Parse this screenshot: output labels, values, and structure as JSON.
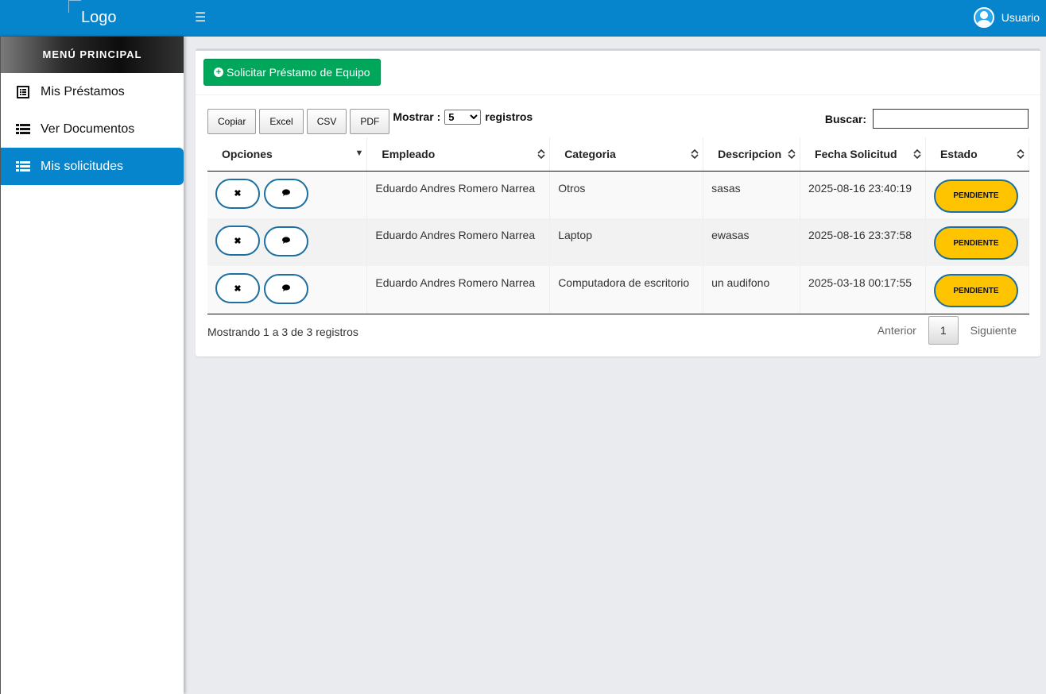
{
  "header": {
    "logo_alt": "Logo",
    "menu_icon": "hamburger-icon",
    "user_label": "Usuario",
    "user_icon": "user-circle-icon",
    "bar_color": "#0785cc"
  },
  "sidebar": {
    "title": "MENÚ PRINCIPAL",
    "items": [
      {
        "label": "Mis Préstamos",
        "icon": "list-alt-icon",
        "active": false
      },
      {
        "label": "Ver Documentos",
        "icon": "list-icon",
        "active": false
      },
      {
        "label": "Mis solicitudes",
        "icon": "list-icon",
        "active": true
      }
    ]
  },
  "main": {
    "request_button": "Solicitar Préstamo de Equipo",
    "export_buttons": [
      "Copiar",
      "Excel",
      "CSV",
      "PDF"
    ],
    "length_label_pre": "Mostrar :",
    "length_value": "5",
    "length_label_post": "registros",
    "search_label": "Buscar:",
    "search_value": "",
    "columns": [
      "Opciones",
      "Empleado",
      "Categoria",
      "Descripcion",
      "Fecha Solicitud",
      "Estado"
    ],
    "rows": [
      {
        "empleado": "Eduardo Andres Romero Narrea",
        "categoria": "Otros",
        "descripcion": "sasas",
        "fecha": "2025-08-16 23:40:19",
        "estado": "PENDIENTE"
      },
      {
        "empleado": "Eduardo Andres Romero Narrea",
        "categoria": "Laptop",
        "descripcion": "ewasas",
        "fecha": "2025-08-16 23:37:58",
        "estado": "PENDIENTE"
      },
      {
        "empleado": "Eduardo Andres Romero Narrea",
        "categoria": "Computadora de escritorio",
        "descripcion": "un audifono",
        "fecha": "2025-03-18 00:17:55",
        "estado": "PENDIENTE"
      }
    ],
    "info": "Mostrando 1 a 3 de 3 registros",
    "pager": {
      "prev": "Anterior",
      "current": "1",
      "next": "Siguiente"
    },
    "accent_green": "#00a65a",
    "status_color": "#ffc400"
  }
}
